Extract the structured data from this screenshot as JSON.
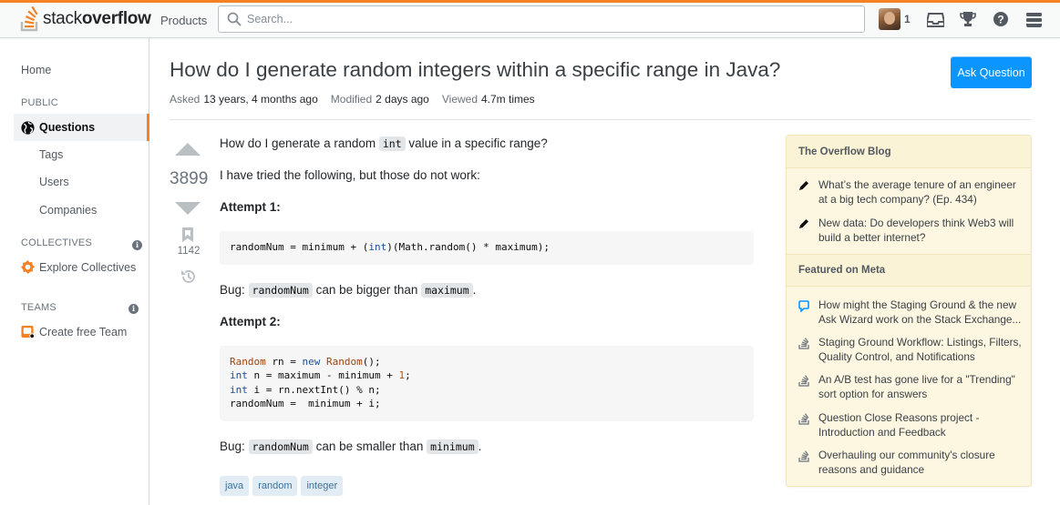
{
  "header": {
    "logo_light": "stack",
    "logo_bold": "overflow",
    "products_label": "Products",
    "search_placeholder": "Search...",
    "reputation": "1"
  },
  "sidebar": {
    "home": "Home",
    "public_heading": "PUBLIC",
    "questions": "Questions",
    "tags": "Tags",
    "users": "Users",
    "companies": "Companies",
    "collectives_heading": "COLLECTIVES",
    "explore_collectives": "Explore Collectives",
    "teams_heading": "TEAMS",
    "create_team": "Create free Team"
  },
  "question": {
    "title": "How do I generate random integers within a specific range in Java?",
    "ask_button": "Ask Question",
    "asked_label": "Asked",
    "asked_value": "13 years, 4 months ago",
    "modified_label": "Modified",
    "modified_value": "2 days ago",
    "viewed_label": "Viewed",
    "viewed_value": "4.7m times",
    "score": "3899",
    "bookmarks": "1142",
    "body": {
      "line1_pre": "How do I generate a random ",
      "line1_code": "int",
      "line1_post": " value in a specific range?",
      "line2": "I have tried the following, but those do not work:",
      "attempt1": "Attempt 1:",
      "bug1_pre": "Bug: ",
      "bug1_code1": "randomNum",
      "bug1_mid": " can be bigger than ",
      "bug1_code2": "maximum",
      "bug1_post": ".",
      "attempt2": "Attempt 2:",
      "bug2_pre": "Bug: ",
      "bug2_code1": "randomNum",
      "bug2_mid": " can be smaller than ",
      "bug2_code2": "minimum",
      "bug2_post": "."
    },
    "tags": [
      "java",
      "random",
      "integer"
    ]
  },
  "right_sidebar": {
    "blog_heading": "The Overflow Blog",
    "blog_items": [
      "What’s the average tenure of an engineer at a big tech company? (Ep. 434)",
      "New data: Do developers think Web3 will build a better internet?"
    ],
    "meta_heading": "Featured on Meta",
    "meta_items": [
      "How might the Staging Ground & the new Ask Wizard work on the Stack Exchange...",
      "Staging Ground Workflow: Listings, Filters, Quality Control, and Notifications",
      "An A/B test has gone live for a \"Trending\" sort option for answers",
      "Question Close Reasons project - Introduction and Feedback",
      "Overhauling our community's closure reasons and guidance"
    ]
  },
  "colors": {
    "accent": "#f48225",
    "primary_button": "#0a95ff",
    "tag_bg": "#e1ecf4",
    "tag_text": "#39739d",
    "widget_bg": "#fdf7e2"
  }
}
